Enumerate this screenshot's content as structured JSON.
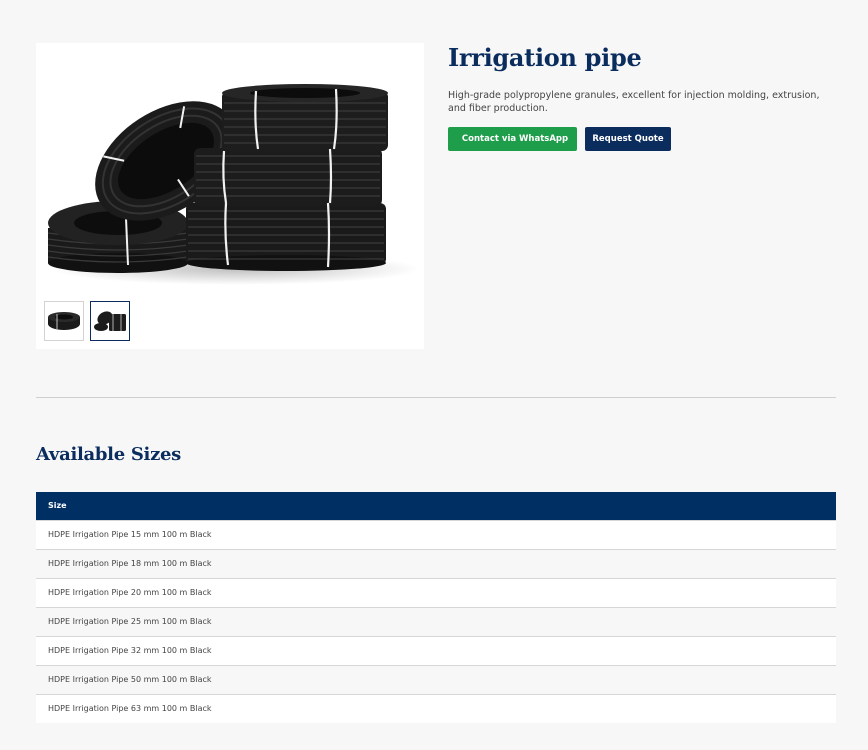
{
  "product": {
    "title": "Irrigation pipe",
    "description": "High-grade polypropylene granules, excellent for injection molding, extrusion, and fiber production.",
    "image_icon": "coiled-black-pipes-image",
    "thumbnails": [
      {
        "icon": "pipe-coil-thumbnail",
        "active": false
      },
      {
        "icon": "pipe-stack-thumbnail",
        "active": true
      }
    ]
  },
  "actions": {
    "whatsapp_label": "Contact via WhatsApp",
    "whatsapp_icon": "chat-bubble-icon",
    "quote_label": "Request Quote"
  },
  "sizes": {
    "heading": "Available Sizes",
    "column_header": "Size",
    "rows": [
      "HDPE Irrigation Pipe 15 mm 100 m Black",
      "HDPE Irrigation Pipe 18 mm 100 m Black",
      "HDPE Irrigation Pipe 20 mm 100 m Black",
      "HDPE Irrigation Pipe 25 mm 100 m Black",
      "HDPE Irrigation Pipe 32 mm 100 m Black",
      "HDPE Irrigation Pipe 50 mm 100 m Black",
      "HDPE Irrigation Pipe 63 mm 100 m Black"
    ]
  },
  "colors": {
    "brand_navy": "#0b2d5e",
    "table_header": "#002f63",
    "whatsapp_green": "#1e9e4a",
    "page_background": "#f7f7f7"
  }
}
